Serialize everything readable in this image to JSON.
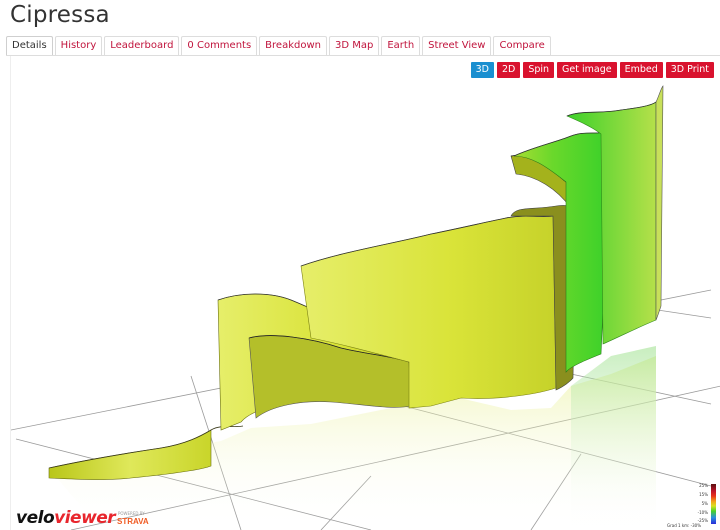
{
  "page": {
    "title": "Cipressa"
  },
  "tabs": [
    {
      "label": "Details",
      "active": true
    },
    {
      "label": "History"
    },
    {
      "label": "Leaderboard"
    },
    {
      "label": "0 Comments"
    },
    {
      "label": "Breakdown"
    },
    {
      "label": "3D Map"
    },
    {
      "label": "Earth"
    },
    {
      "label": "Street View"
    },
    {
      "label": "Compare"
    }
  ],
  "toolbar": {
    "view_3d": "3D",
    "view_2d": "2D",
    "spin": "Spin",
    "get_image": "Get image",
    "embed": "Embed",
    "print_3d": "3D Print"
  },
  "brand": {
    "velo": "velo",
    "viewer": "viewer",
    "powered": "POWERED BY",
    "strava": "STRAVA"
  },
  "legend": {
    "labels": [
      "25%",
      "15%",
      "5%",
      "-10%",
      "-25%"
    ],
    "note": "Grad 1 km: -30%"
  },
  "colors": {
    "tab_link": "#c0143c",
    "button_red": "#d9122e",
    "button_active": "#1a8fd0",
    "profile_yellow": "#d6e23a",
    "profile_green": "#3fd52a"
  }
}
